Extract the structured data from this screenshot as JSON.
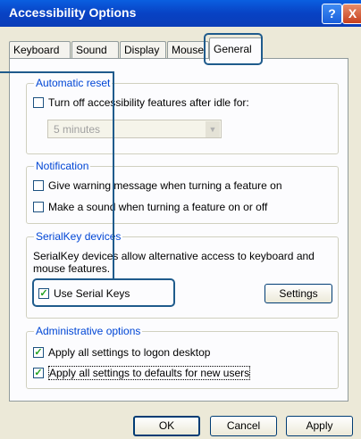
{
  "window": {
    "title": "Accessibility Options"
  },
  "titlebar": {
    "help_glyph": "?",
    "close_glyph": "X"
  },
  "tabs": [
    {
      "label": "Keyboard"
    },
    {
      "label": "Sound"
    },
    {
      "label": "Display"
    },
    {
      "label": "Mouse"
    },
    {
      "label": "General"
    }
  ],
  "automatic_reset": {
    "group_label": "Automatic reset",
    "checkbox_label": "Turn off accessibility features after idle for:",
    "checked": false,
    "idle_select_value": "5 minutes"
  },
  "notification": {
    "group_label": "Notification",
    "warning_label": "Give warning message when turning a feature on",
    "warning_checked": false,
    "sound_label": "Make a sound when turning a feature on or off",
    "sound_checked": false
  },
  "serialkey": {
    "group_label": "SerialKey devices",
    "description": "SerialKey devices allow alternative access to keyboard and mouse features.",
    "checkbox_label": "Use Serial Keys",
    "checked": true,
    "settings_button": "Settings"
  },
  "admin": {
    "group_label": "Administrative options",
    "logon_label": "Apply all settings to logon desktop",
    "logon_checked": true,
    "defaults_label": "Apply all settings to defaults for new users",
    "defaults_checked": true
  },
  "buttons": {
    "ok": "OK",
    "cancel": "Cancel",
    "apply": "Apply"
  },
  "colors": {
    "titlebar": "#0a5fe0",
    "group_label": "#0046d5",
    "highlight": "#1f5b8c",
    "background": "#ece9d8"
  }
}
